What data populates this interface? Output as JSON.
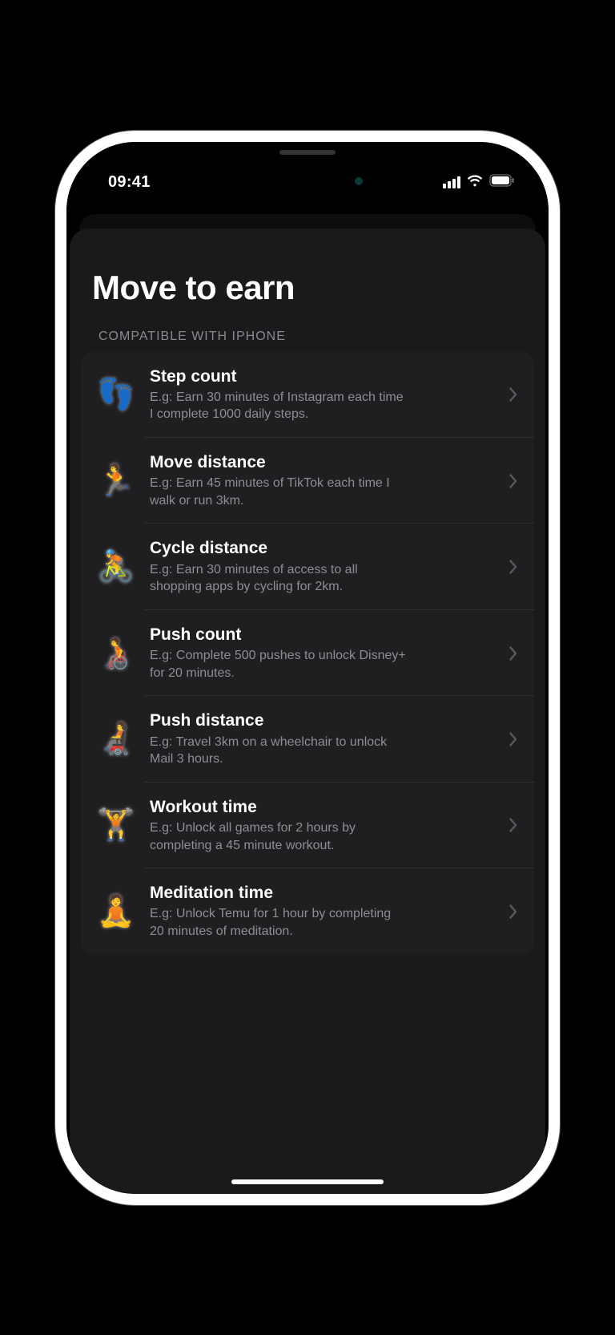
{
  "status_bar": {
    "time": "09:41"
  },
  "page": {
    "title": "Move to earn",
    "section_label": "COMPATIBLE WITH IPHONE"
  },
  "items": [
    {
      "icon": "👣",
      "icon_name": "footprints-icon",
      "title": "Step count",
      "subtitle": "E.g: Earn 30 minutes of Instagram each time I complete 1000 daily steps."
    },
    {
      "icon": "🏃",
      "icon_name": "runner-icon",
      "title": "Move distance",
      "subtitle": "E.g: Earn 45 minutes of TikTok each time I walk or run 3km."
    },
    {
      "icon": "🚴",
      "icon_name": "cyclist-icon",
      "title": "Cycle distance",
      "subtitle": "E.g: Earn 30 minutes of access to all shopping apps by cycling for 2km."
    },
    {
      "icon": "🧑‍🦽",
      "icon_name": "wheelchair-icon",
      "title": "Push count",
      "subtitle": "E.g: Complete 500 pushes to unlock Disney+ for 20 minutes."
    },
    {
      "icon": "🧑‍🦼",
      "icon_name": "motorized-wheelchair-icon",
      "title": "Push distance",
      "subtitle": "E.g: Travel 3km on a wheelchair to unlock Mail 3 hours."
    },
    {
      "icon": "🏋️",
      "icon_name": "weightlifter-icon",
      "title": "Workout time",
      "subtitle": "E.g: Unlock all games for 2 hours by completing a 45 minute workout."
    },
    {
      "icon": "🧘",
      "icon_name": "meditation-icon",
      "title": "Meditation time",
      "subtitle": "E.g: Unlock Temu for 1 hour by completing 20 minutes of meditation."
    }
  ]
}
